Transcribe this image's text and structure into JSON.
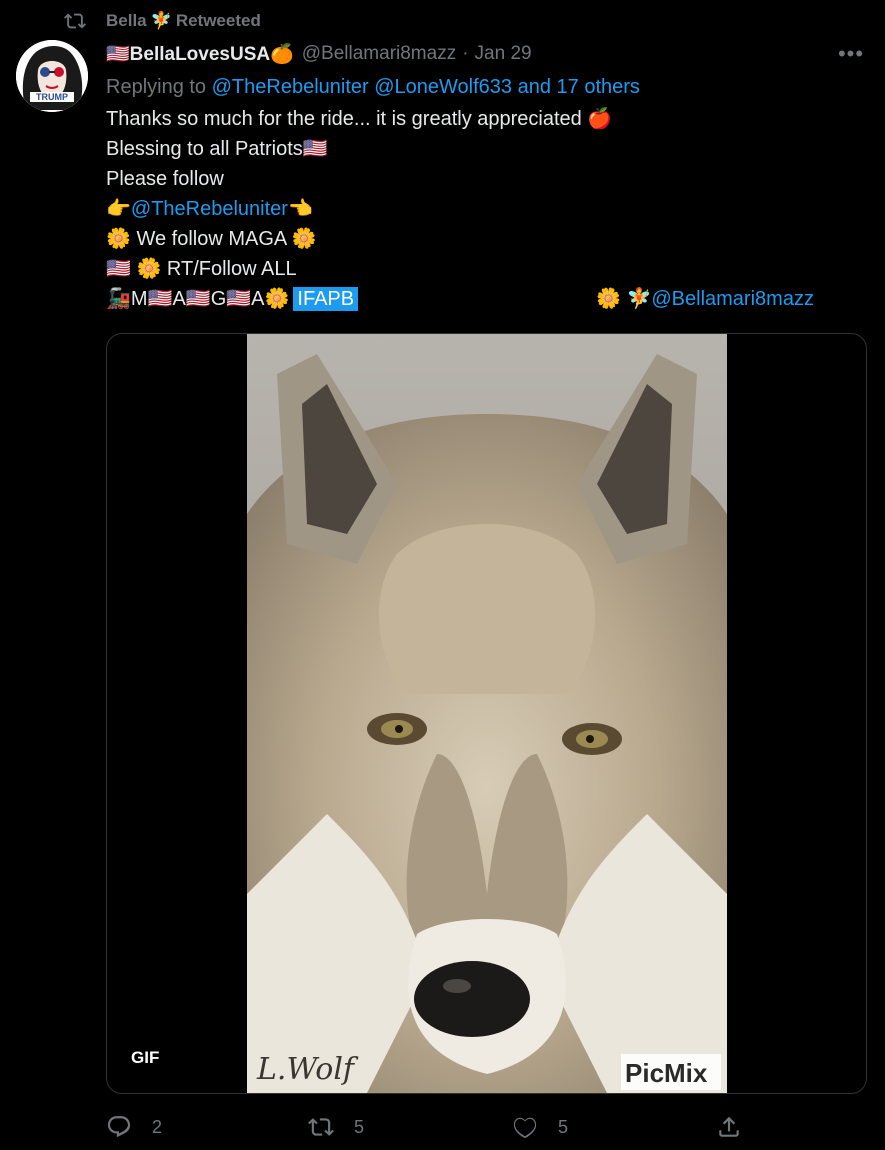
{
  "retweet_bar": {
    "name": "Bella",
    "name_emoji": "🧚",
    "suffix": "Retweeted"
  },
  "author": {
    "display_name": "🇺🇸BellaLovesUSA🍊",
    "handle": "@Bellamari8mazz",
    "separator": "·",
    "date": "Jan 29",
    "avatar_text": "TRUMP"
  },
  "reply": {
    "prefix": "Replying to",
    "mentions": "@TheRebeluniter @LoneWolf633 and 17 others"
  },
  "body": {
    "line1": "Thanks so much for the ride... it is greatly appreciated 🍎",
    "line2": "Blessing to all Patriots🇺🇸",
    "line3": "Please follow",
    "line4_left": "👉",
    "line4_mention": "@TheRebeluniter",
    "line4_right": " 👈",
    "line5": "🌼 We follow MAGA 🌼",
    "line6": "🇺🇸 🌼  RT/Follow ALL",
    "line7_prefix": "🚂M🇺🇸A🇺🇸G🇺🇸A ",
    "line7_flower": "🌼",
    "line7_tag": "IFAPB",
    "line7_right_emoji": "🌼 🧚",
    "line7_right_mention": "@Bellamari8mazz"
  },
  "media": {
    "badge": "GIF",
    "watermark_left": "L.Wolf",
    "watermark_right": "PicMix"
  },
  "actions": {
    "reply_count": "2",
    "retweet_count": "5",
    "like_count": "5"
  },
  "colors": {
    "background": "#000000",
    "text": "#e7e9ea",
    "muted": "#71767b",
    "link": "#1d9bf0"
  }
}
